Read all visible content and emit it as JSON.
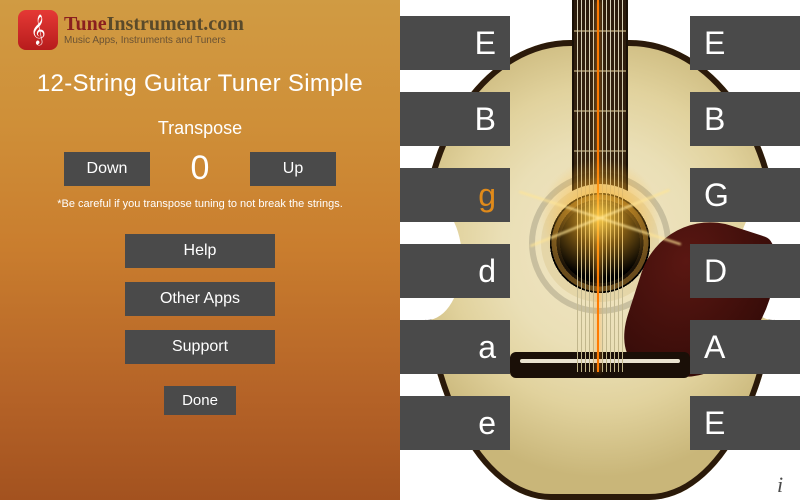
{
  "brand": {
    "name_tune": "Tune",
    "name_rest": "Instrument.com",
    "tagline": "Music Apps, Instruments and Tuners",
    "icon_glyph": "𝄞"
  },
  "title": "12-String Guitar Tuner Simple",
  "transpose": {
    "label": "Transpose",
    "down": "Down",
    "up": "Up",
    "value": "0",
    "warning": "*Be careful if you transpose tuning to not break the strings."
  },
  "menu": {
    "help": "Help",
    "other_apps": "Other Apps",
    "support": "Support",
    "done": "Done"
  },
  "strings": {
    "left": [
      "E",
      "B",
      "g",
      "d",
      "a",
      "e"
    ],
    "right": [
      "E",
      "B",
      "G",
      "D",
      "A",
      "E"
    ],
    "active_left_index": 2
  },
  "info_label": "i",
  "colors": {
    "button_bg": "#4a4a4a",
    "active_note": "#e08a1a",
    "panel_top": "#d09b43",
    "panel_bottom": "#a3521f"
  }
}
